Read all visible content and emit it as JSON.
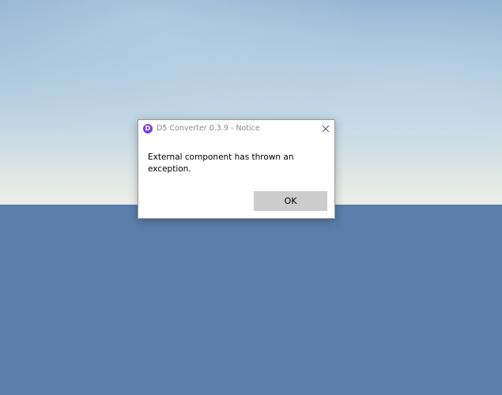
{
  "background": {
    "sky_color_top": "#8fb3d3",
    "sky_color_horizon": "#ecede7",
    "ground_color": "#5a7da9"
  },
  "dialog": {
    "app_icon": {
      "name": "d5-logo-icon",
      "glyph": "D",
      "color": "#7b3fe4"
    },
    "title": "D5 Converter 0.3.9 - Notice",
    "close_icon": "close-icon",
    "message": "External component has thrown an exception.",
    "ok_label": "OK",
    "ok_button_color": "#cccccc"
  }
}
